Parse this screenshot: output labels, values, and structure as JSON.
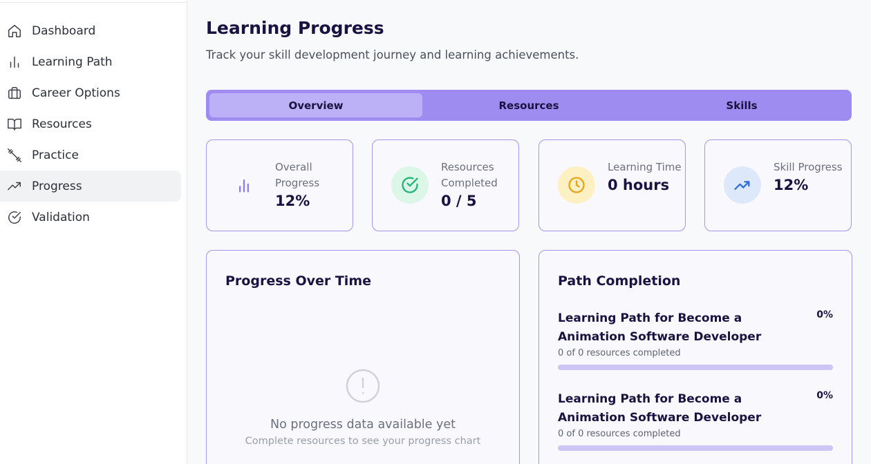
{
  "sidebar": {
    "items": [
      {
        "label": "Dashboard",
        "icon": "home-icon",
        "active": false
      },
      {
        "label": "Learning Path",
        "icon": "bar-chart-icon",
        "active": false
      },
      {
        "label": "Career Options",
        "icon": "briefcase-icon",
        "active": false
      },
      {
        "label": "Resources",
        "icon": "book-open-icon",
        "active": false
      },
      {
        "label": "Practice",
        "icon": "dumbbell-icon",
        "active": false
      },
      {
        "label": "Progress",
        "icon": "trending-up-icon",
        "active": true
      },
      {
        "label": "Validation",
        "icon": "check-circle-icon",
        "active": false
      }
    ]
  },
  "header": {
    "title": "Learning Progress",
    "subtitle": "Track your skill development journey and learning achievements."
  },
  "tabs": [
    {
      "label": "Overview",
      "active": true
    },
    {
      "label": "Resources",
      "active": false
    },
    {
      "label": "Skills",
      "active": false
    }
  ],
  "stats": [
    {
      "label": "Overall Progress",
      "value": "12%",
      "icon": "bar-chart-icon",
      "color": "#8b7cf0",
      "bg": "transparent"
    },
    {
      "label": "Resources Completed",
      "value": "0 / 5",
      "icon": "check-circle-icon",
      "color": "#22b573",
      "bg": "#dcf7e8"
    },
    {
      "label": "Learning Time",
      "value": "0 hours",
      "icon": "clock-icon",
      "color": "#e8a317",
      "bg": "#fdf1c4"
    },
    {
      "label": "Skill Progress",
      "value": "12%",
      "icon": "trending-up-icon",
      "color": "#2f6fe0",
      "bg": "#dde9fb"
    }
  ],
  "progress_chart": {
    "title": "Progress Over Time",
    "empty_icon": "alert-circle-icon",
    "empty_title": "No progress data available yet",
    "empty_subtitle": "Complete resources to see your progress chart"
  },
  "path_completion": {
    "title": "Path Completion",
    "items": [
      {
        "name": "Learning Path for Become a Animation Software Developer",
        "percent": "0%",
        "progress": 0,
        "count": "0 of 0 resources completed"
      },
      {
        "name": "Learning Path for Become a Animation Software Developer",
        "percent": "0%",
        "progress": 0,
        "count": "0 of 0 resources completed"
      }
    ]
  }
}
